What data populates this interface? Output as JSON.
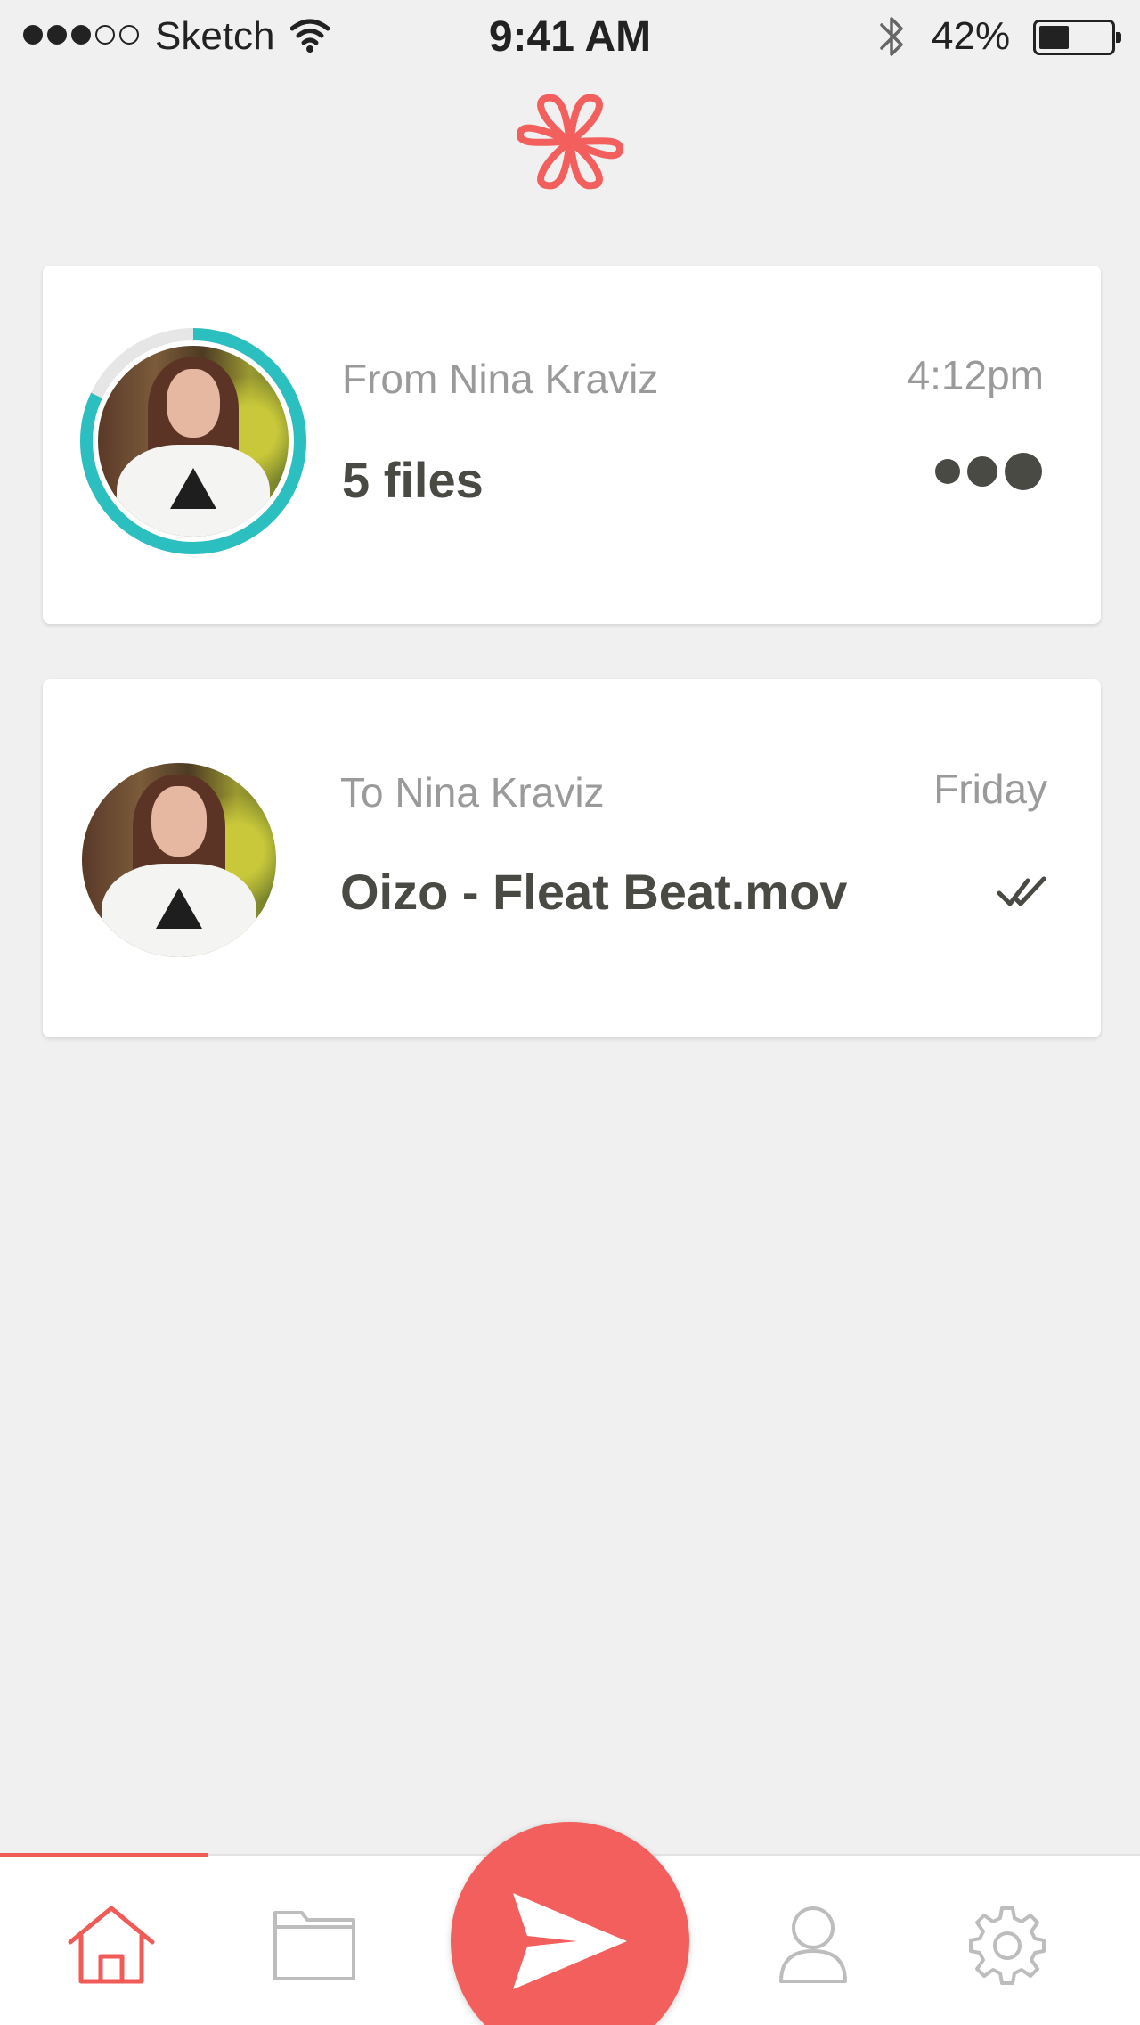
{
  "status_bar": {
    "carrier": "Sketch",
    "time": "9:41 AM",
    "battery_percent": "42%",
    "battery_level": 0.42,
    "signal_filled": 3,
    "signal_total": 5
  },
  "app": {
    "logo_icon": "command-cloverleaf-icon",
    "accent_color": "#f25f5c",
    "progress_color": "#2bbfbf"
  },
  "transfers": [
    {
      "direction_label": "From Nina Kraviz",
      "title": "5 files",
      "time": "4:12pm",
      "status_icon": "progress-dots-icon",
      "progress": 0.82
    },
    {
      "direction_label": "To Nina Kraviz",
      "title": "Oizo - Fleat Beat.mov",
      "time": "Friday",
      "status_icon": "double-check-icon"
    }
  ],
  "tabbar": {
    "items": [
      "home-icon",
      "folder-icon",
      "send-icon",
      "person-icon",
      "gear-icon"
    ],
    "active": "home-icon"
  }
}
